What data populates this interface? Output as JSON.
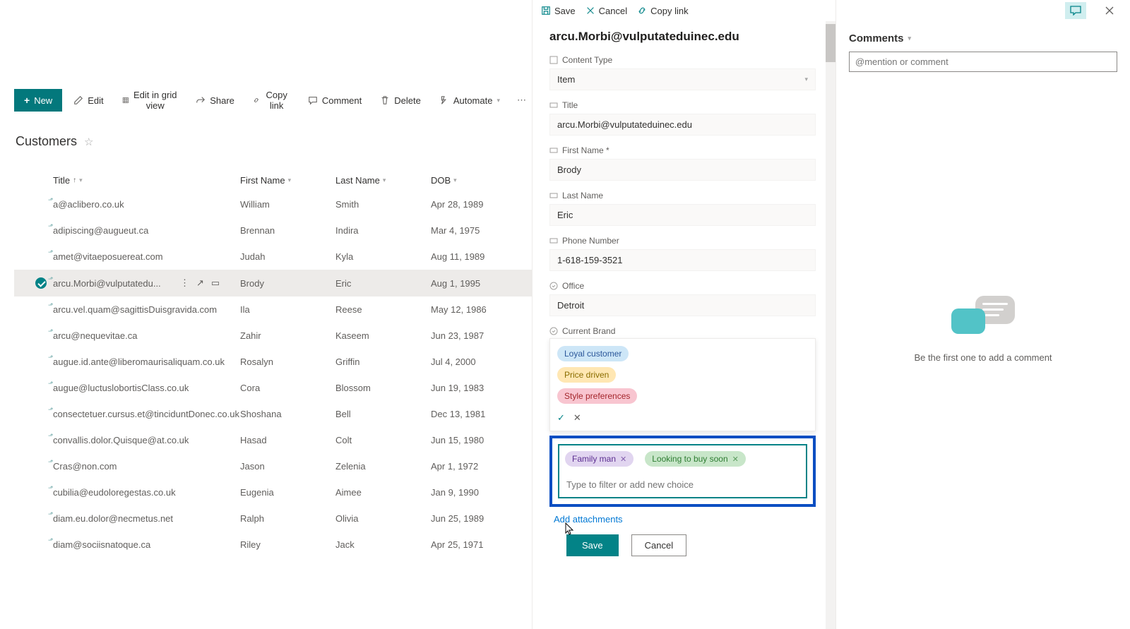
{
  "toolbar": {
    "new_label": "New",
    "edit_label": "Edit",
    "edit_grid_label": "Edit in grid view",
    "share_label": "Share",
    "copylink_label": "Copy link",
    "comment_label": "Comment",
    "delete_label": "Delete",
    "automate_label": "Automate"
  },
  "list": {
    "title": "Customers",
    "columns": {
      "title": "Title",
      "fn": "First Name",
      "ln": "Last Name",
      "dob": "DOB"
    },
    "rows": [
      {
        "title": "a@aclibero.co.uk",
        "fn": "William",
        "ln": "Smith",
        "dob": "Apr 28, 1989"
      },
      {
        "title": "adipiscing@augueut.ca",
        "fn": "Brennan",
        "ln": "Indira",
        "dob": "Mar 4, 1975"
      },
      {
        "title": "amet@vitaeposuereat.com",
        "fn": "Judah",
        "ln": "Kyla",
        "dob": "Aug 11, 1989"
      },
      {
        "title": "arcu.Morbi@vulputatedu...",
        "fn": "Brody",
        "ln": "Eric",
        "dob": "Aug 1, 1995"
      },
      {
        "title": "arcu.vel.quam@sagittisDuisgravida.com",
        "fn": "Ila",
        "ln": "Reese",
        "dob": "May 12, 1986"
      },
      {
        "title": "arcu@nequevitae.ca",
        "fn": "Zahir",
        "ln": "Kaseem",
        "dob": "Jun 23, 1987"
      },
      {
        "title": "augue.id.ante@liberomaurisaliquam.co.uk",
        "fn": "Rosalyn",
        "ln": "Griffin",
        "dob": "Jul 4, 2000"
      },
      {
        "title": "augue@luctuslobortisClass.co.uk",
        "fn": "Cora",
        "ln": "Blossom",
        "dob": "Jun 19, 1983"
      },
      {
        "title": "consectetuer.cursus.et@tinciduntDonec.co.uk",
        "fn": "Shoshana",
        "ln": "Bell",
        "dob": "Dec 13, 1981"
      },
      {
        "title": "convallis.dolor.Quisque@at.co.uk",
        "fn": "Hasad",
        "ln": "Colt",
        "dob": "Jun 15, 1980"
      },
      {
        "title": "Cras@non.com",
        "fn": "Jason",
        "ln": "Zelenia",
        "dob": "Apr 1, 1972"
      },
      {
        "title": "cubilia@eudoloregestas.co.uk",
        "fn": "Eugenia",
        "ln": "Aimee",
        "dob": "Jan 9, 1990"
      },
      {
        "title": "diam.eu.dolor@necmetus.net",
        "fn": "Ralph",
        "ln": "Olivia",
        "dob": "Jun 25, 1989"
      },
      {
        "title": "diam@sociisnatoque.ca",
        "fn": "Riley",
        "ln": "Jack",
        "dob": "Apr 25, 1971"
      }
    ],
    "selected_index": 3
  },
  "panel": {
    "save_label": "Save",
    "cancel_label": "Cancel",
    "copylink_label": "Copy link",
    "item_title": "arcu.Morbi@vulputateduinec.edu",
    "fields": {
      "content_type": {
        "label": "Content Type",
        "value": "Item"
      },
      "title": {
        "label": "Title",
        "value": "arcu.Morbi@vulputateduinec.edu"
      },
      "first_name": {
        "label": "First Name *",
        "value": "Brody"
      },
      "last_name": {
        "label": "Last Name",
        "value": "Eric"
      },
      "phone": {
        "label": "Phone Number",
        "value": "1-618-159-3521"
      },
      "office": {
        "label": "Office",
        "value": "Detroit"
      },
      "current_brand": {
        "label": "Current Brand"
      }
    },
    "dropdown_options": [
      "Loyal customer",
      "Price driven",
      "Style preferences"
    ],
    "selected_tags": [
      "Family man",
      "Looking to buy soon"
    ],
    "filter_placeholder": "Type to filter or add new choice",
    "attachments_label": "Add attachments",
    "footer": {
      "save": "Save",
      "cancel": "Cancel"
    }
  },
  "comments": {
    "header": "Comments",
    "placeholder": "@mention or comment",
    "empty_text": "Be the first one to add a comment"
  }
}
